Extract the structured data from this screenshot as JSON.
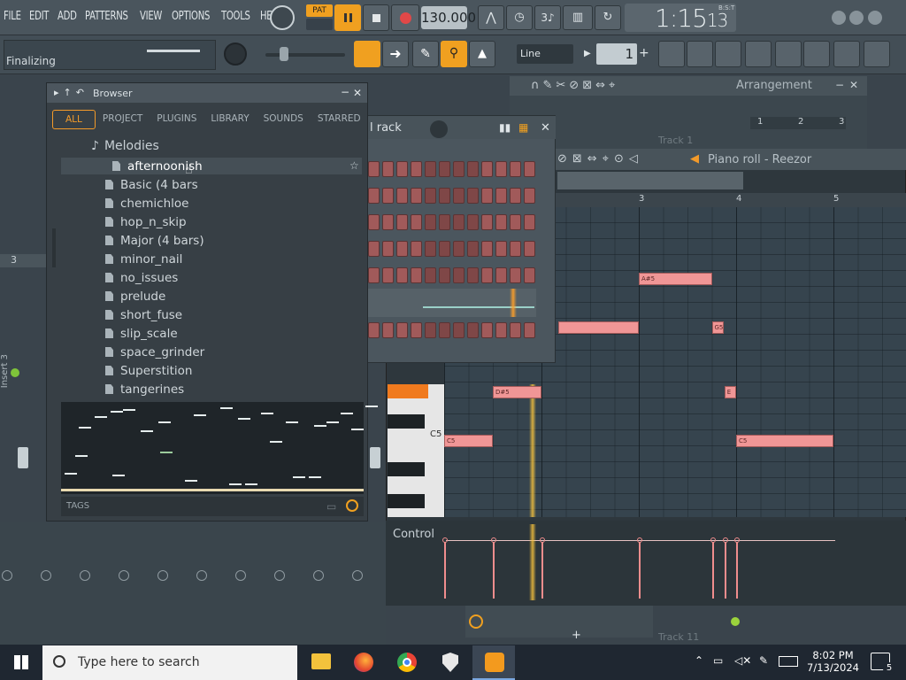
{
  "menu": [
    "FILE",
    "EDIT",
    "ADD",
    "PATTERNS",
    "VIEW",
    "OPTIONS",
    "TOOLS",
    "HELP"
  ],
  "transport": {
    "pat_label": "PAT",
    "tempo": "130.000",
    "time": "1:15",
    "time_frac": "13",
    "time_sub": "B:S:T"
  },
  "hint": "Finalizing",
  "snap": "Line",
  "pattern_number": "1",
  "browser": {
    "title": "Browser",
    "tabs": [
      "ALL",
      "PROJECT",
      "PLUGINS",
      "LIBRARY",
      "SOUNDS",
      "STARRED"
    ],
    "folder": "Melodies",
    "files": [
      "afternoonish",
      "Basic (4 bars",
      "chemichloe",
      "hop_n_skip",
      "Major (4 bars)",
      "minor_nail",
      "no_issues",
      "prelude",
      "short_fuse",
      "slip_scale",
      "space_grinder",
      "Superstition",
      "tangerines"
    ],
    "tags_label": "TAGS"
  },
  "rack": {
    "title": "l rack"
  },
  "piano_roll": {
    "title": "Piano roll - Reezor",
    "bar_numbers": [
      "3",
      "4",
      "5"
    ],
    "key_label": "C5",
    "notes": [
      {
        "label": "A#5",
        "x": 3.0,
        "row": 1,
        "len": 0.75
      },
      {
        "label": "",
        "x": 2.17,
        "row": 4,
        "len": 0.83
      },
      {
        "label": "G5",
        "x": 3.75,
        "row": 4,
        "len": 0.12
      },
      {
        "label": "D#5",
        "x": 1.5,
        "row": 8,
        "len": 0.5
      },
      {
        "label": "E",
        "x": 3.88,
        "row": 8,
        "len": 0.12
      },
      {
        "label": "C5",
        "x": 1.0,
        "row": 11,
        "len": 0.5
      },
      {
        "label": "C5",
        "x": 4.0,
        "row": 11,
        "len": 1.0
      }
    ]
  },
  "control": {
    "label": "Control",
    "velocity_x": [
      1.0,
      1.5,
      2.0,
      3.0,
      3.75,
      3.88,
      4.0
    ]
  },
  "arrangement": {
    "title": "Arrangement",
    "track_1": "Track 1",
    "track_11": "Track 11",
    "bar_numbers": [
      "1",
      "2",
      "3"
    ]
  },
  "mixer": {
    "insert_label": "Insert 3",
    "insert_num": "3"
  },
  "taskbar": {
    "search_placeholder": "Type here to search",
    "time": "8:02 PM",
    "date": "7/13/2024",
    "notif_count": "5"
  },
  "colors": {
    "accent": "#f29a2a",
    "note": "#f09696",
    "play": "#e04848"
  }
}
